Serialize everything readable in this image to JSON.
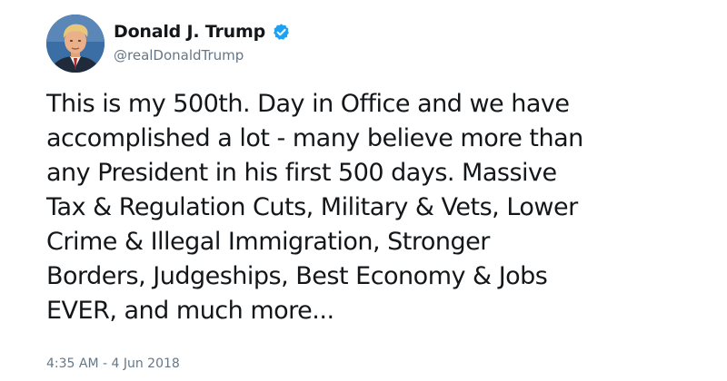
{
  "tweet": {
    "author": {
      "display_name": "Donald J. Trump",
      "handle": "@realDonaldTrump",
      "verified": true,
      "avatar_icon": "profile-photo"
    },
    "text": "This is my 500th. Day in Office and we have\naccomplished a lot - many believe more than\nany President in his first 500 days. Massive\nTax & Regulation Cuts, Military & Vets, Lower\nCrime & Illegal Immigration, Stronger\nBorders, Judgeships, Best Economy & Jobs\nEVER, and much more...",
    "timestamp": "4:35 AM - 4 Jun 2018"
  },
  "colors": {
    "text_primary": "#14171a",
    "text_secondary": "#657786",
    "verified_blue": "#1da1f2",
    "background": "#ffffff"
  }
}
